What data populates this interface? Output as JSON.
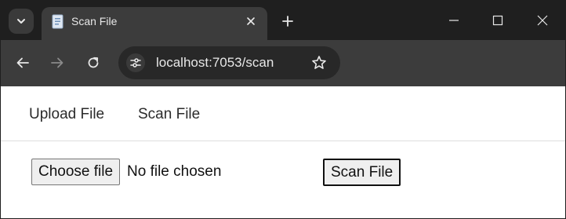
{
  "browser": {
    "tab": {
      "title": "Scan File",
      "favicon": "document-icon"
    },
    "new_tab_symbol": "+",
    "address_bar": {
      "url": "localhost:7053/scan"
    },
    "icons": {
      "tab_search": "chevron-down-icon",
      "tab_close": "close-icon",
      "new_tab": "plus-icon",
      "minimize": "minimize-icon",
      "maximize": "maximize-icon",
      "close_window": "close-icon",
      "back": "arrow-left-icon",
      "forward": "arrow-right-icon",
      "reload": "reload-icon",
      "site_info": "tune-icon",
      "bookmark": "star-icon"
    },
    "colors": {
      "tabstrip_bg": "#1f1f1f",
      "toolbar_bg": "#3c3c3c",
      "omnibox_bg": "#282828",
      "text_light": "#e8e8e8"
    }
  },
  "page": {
    "nav": {
      "upload_link": "Upload File",
      "scan_link": "Scan File"
    },
    "file_input": {
      "button_label": "Choose file",
      "status": "No file chosen"
    },
    "scan_button": {
      "label": "Scan File"
    }
  }
}
